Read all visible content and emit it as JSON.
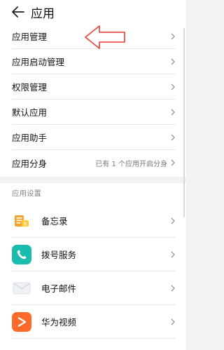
{
  "header": {
    "title": "应用"
  },
  "menu": {
    "items": [
      {
        "label": "应用管理",
        "value": ""
      },
      {
        "label": "应用启动管理",
        "value": ""
      },
      {
        "label": "权限管理",
        "value": ""
      },
      {
        "label": "默认应用",
        "value": ""
      },
      {
        "label": "应用助手",
        "value": ""
      },
      {
        "label": "应用分身",
        "value": "已有 1 个应用开启分身"
      }
    ]
  },
  "settings": {
    "section_title": "应用设置",
    "apps": [
      {
        "label": "备忘录",
        "icon": "memo-icon",
        "color": "#f3a22b"
      },
      {
        "label": "拨号服务",
        "icon": "phone-icon",
        "color": "#1bbcb0"
      },
      {
        "label": "电子邮件",
        "icon": "email-icon",
        "color": "#e8ecf1"
      },
      {
        "label": "华为视频",
        "icon": "video-icon",
        "color": "#ff6a2b"
      }
    ]
  },
  "annotation": {
    "color": "#e8534a"
  }
}
